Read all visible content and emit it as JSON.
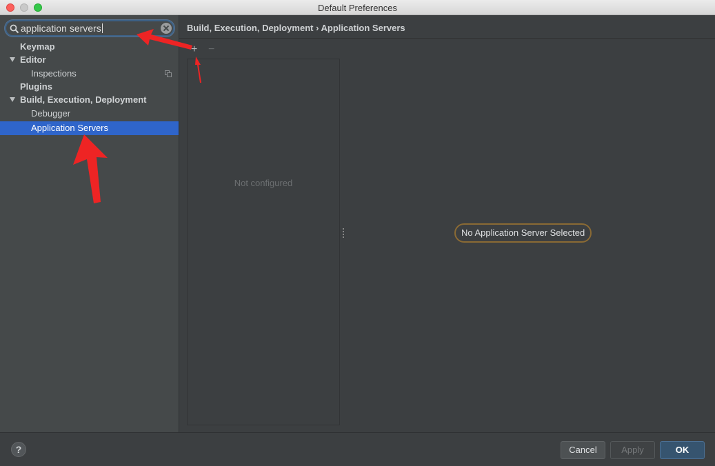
{
  "window": {
    "title": "Default Preferences"
  },
  "search": {
    "value": "application servers"
  },
  "tree": [
    {
      "label": "Keymap",
      "level": 0,
      "expanded": false
    },
    {
      "label": "Editor",
      "level": 0,
      "expanded": true
    },
    {
      "label": "Inspections",
      "level": 1
    },
    {
      "label": "Plugins",
      "level": 0,
      "expanded": false
    },
    {
      "label": "Build, Execution, Deployment",
      "level": 0,
      "expanded": true
    },
    {
      "label": "Debugger",
      "level": 1
    },
    {
      "label": "Application Servers",
      "level": 1,
      "selected": true
    }
  ],
  "main": {
    "breadcrumb": "Build, Execution, Deployment › Application Servers",
    "add_symbol": "+",
    "remove_symbol": "−",
    "empty_list_text": "Not configured",
    "status_text": "No Application Server Selected"
  },
  "footer": {
    "help_symbol": "?",
    "cancel_label": "Cancel",
    "apply_label": "Apply",
    "ok_label": "OK"
  },
  "colors": {
    "selection": "#2f65ca",
    "annotation_arrow": "#ee2424",
    "search_focus": "#3d6185"
  },
  "icons": {
    "search": "search-icon",
    "clear": "clear-icon",
    "copy": "copy-icon",
    "expand": "triangle-down-icon"
  }
}
